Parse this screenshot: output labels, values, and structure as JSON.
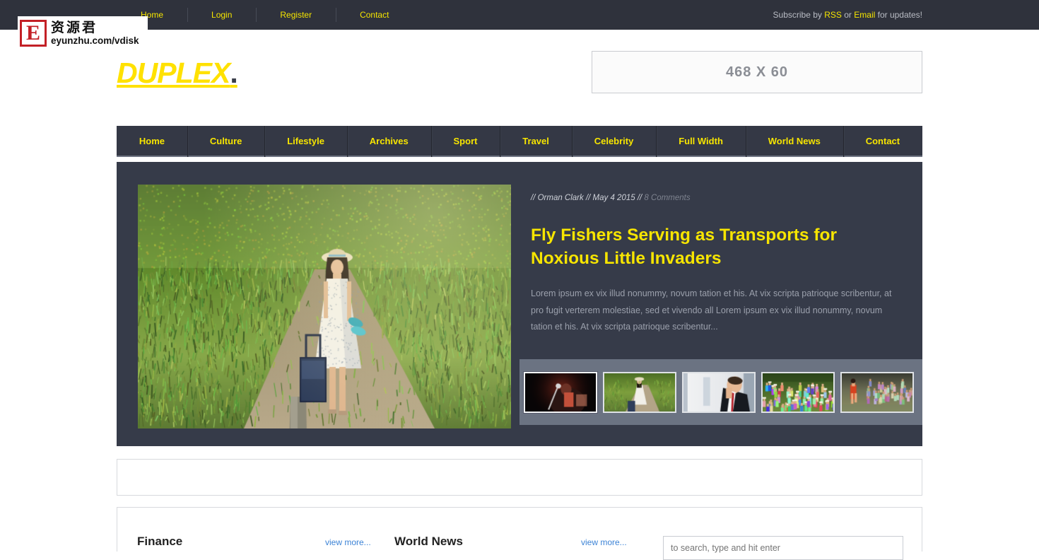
{
  "topbar": {
    "nav": [
      {
        "label": "Home"
      },
      {
        "label": "Login"
      },
      {
        "label": "Register"
      },
      {
        "label": "Contact"
      }
    ],
    "subscribe_prefix": "Subscribe by ",
    "rss_label": "RSS",
    "subscribe_middle": " or ",
    "email_label": "Email",
    "subscribe_suffix": " for updates!"
  },
  "header": {
    "logo_text": "DUPLEX",
    "logo_dot": ".",
    "ad_label": "468 X 60"
  },
  "mainnav": {
    "items": [
      {
        "label": "Home"
      },
      {
        "label": "Culture"
      },
      {
        "label": "Lifestyle"
      },
      {
        "label": "Archives"
      },
      {
        "label": "Sport"
      },
      {
        "label": "Travel"
      },
      {
        "label": "Celebrity"
      },
      {
        "label": "Full Width"
      },
      {
        "label": "World News"
      },
      {
        "label": "Contact"
      }
    ]
  },
  "featured": {
    "meta": "// Orman Clark // May 4 2015 // ",
    "comments": "8 Comments",
    "title": "Fly Fishers Serving as Transports for Noxious Little Invaders",
    "excerpt": "Lorem ipsum ex vix illud nonummy, novum tation et his. At vix scripta patrioque scribentur, at pro fugit verterem molestiae, sed et vivendo all Lorem ipsum ex vix illud nonummy, novum tation et his. At vix scripta patrioque scribentur...",
    "thumbnails": [
      {
        "name": "thumb-singer-stage",
        "selected": true
      },
      {
        "name": "thumb-woman-path",
        "selected": false
      },
      {
        "name": "thumb-businessman-window",
        "selected": false
      },
      {
        "name": "thumb-crowd-outdoor",
        "selected": false
      },
      {
        "name": "thumb-runner-track",
        "selected": false
      }
    ]
  },
  "bottom": {
    "finance_title": "Finance",
    "worldnews_title": "World News",
    "view_more_label": "view more...",
    "search_placeholder": "to search, type and hit enter"
  },
  "watermark": {
    "letter": "E",
    "chinese": "资源君",
    "url": "eyunzhu.com/vdisk"
  },
  "colors": {
    "accent_yellow": "#F7E500",
    "dark_panel": "#363b49",
    "topbar": "#2f323c",
    "nav": "#343845",
    "link_blue": "#3c83d6",
    "thumbstrip": "#6b7382"
  }
}
